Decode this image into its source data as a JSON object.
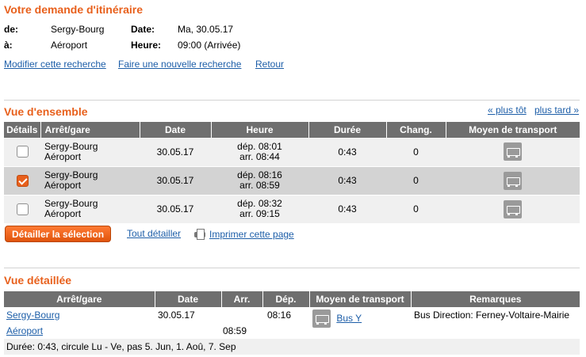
{
  "request": {
    "title": "Votre demande d'itinéraire",
    "from_label": "de:",
    "from_value": "Sergy-Bourg",
    "to_label": "à:",
    "to_value": "Aéroport",
    "date_label": "Date:",
    "date_value": "Ma, 30.05.17",
    "time_label": "Heure:",
    "time_value": "09:00 (Arrivée)",
    "links": {
      "modify": "Modifier cette recherche",
      "new": "Faire une nouvelle recherche",
      "back": "Retour"
    }
  },
  "overview": {
    "title": "Vue d'ensemble",
    "earlier": "« plus tôt",
    "later": "plus tard »",
    "headers": {
      "details": "Détails",
      "stop": "Arrêt/gare",
      "date": "Date",
      "time": "Heure",
      "duration": "Durée",
      "changes": "Chang.",
      "transport": "Moyen de transport"
    },
    "rows": [
      {
        "from": "Sergy-Bourg",
        "to": "Aéroport",
        "date": "30.05.17",
        "dep": "dép. 08:01",
        "arr": "arr. 08:44",
        "duration": "0:43",
        "changes": "0",
        "checked": false,
        "icon": "bus-icon"
      },
      {
        "from": "Sergy-Bourg",
        "to": "Aéroport",
        "date": "30.05.17",
        "dep": "dép. 08:16",
        "arr": "arr. 08:59",
        "duration": "0:43",
        "changes": "0",
        "checked": true,
        "icon": "bus-icon"
      },
      {
        "from": "Sergy-Bourg",
        "to": "Aéroport",
        "date": "30.05.17",
        "dep": "dép. 08:32",
        "arr": "arr. 09:15",
        "duration": "0:43",
        "changes": "0",
        "checked": false,
        "icon": "bus-icon"
      }
    ],
    "actions": {
      "detail_selection": "Détailler la sélection",
      "detail_all": "Tout détailler",
      "print": "Imprimer cette page"
    }
  },
  "detailed": {
    "title": "Vue détaillée",
    "headers": {
      "stop": "Arrêt/gare",
      "date": "Date",
      "arr": "Arr.",
      "dep": "Dép.",
      "transport": "Moyen de transport",
      "remarks": "Remarques"
    },
    "from_stop": "Sergy-Bourg",
    "to_stop": "Aéroport",
    "date": "30.05.17",
    "dep": "08:16",
    "arr": "08:59",
    "transport": "Bus Y",
    "remarks": "Bus Direction: Ferney-Voltaire-Mairie",
    "footer": "Durée: 0:43, circule Lu - Ve, pas 5. Jun, 1. Aoû, 7. Sep"
  },
  "colors": {
    "accent": "#e8601c",
    "link": "#1d5ea8",
    "header_bg": "#6f6f6f",
    "row_alt": "#f0f0f0",
    "row_selected": "#d3d3d3"
  }
}
